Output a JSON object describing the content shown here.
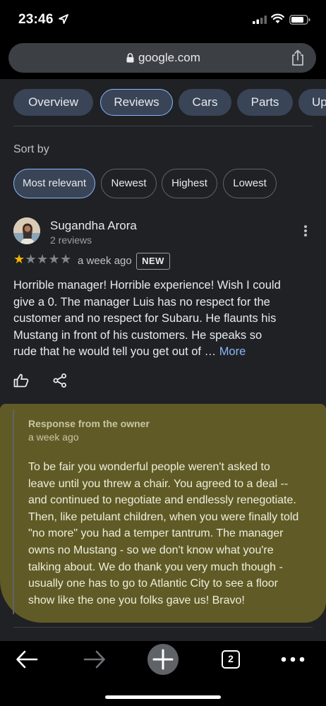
{
  "status_bar": {
    "time": "23:46",
    "icons": [
      "location-arrow-icon",
      "signal-icon",
      "wifi-icon",
      "battery-icon"
    ]
  },
  "browser": {
    "url": "google.com",
    "icons": [
      "lock-icon",
      "share-icon"
    ]
  },
  "tabs": [
    "Overview",
    "Reviews",
    "Cars",
    "Parts",
    "Up"
  ],
  "active_tab": "Reviews",
  "sort": {
    "label": "Sort by",
    "options": [
      "Most relevant",
      "Newest",
      "Highest",
      "Lowest"
    ],
    "selected": "Most relevant"
  },
  "review": {
    "author": "Sugandha Arora",
    "author_reviews": "2 reviews",
    "rating": 1,
    "max_rating": 5,
    "time": "a week ago",
    "badge": "NEW",
    "text_lines": [
      "Horrible manager! Horrible experience! Wish I could",
      "give a 0. The manager Luis has no respect for the",
      "customer and no respect for Subaru. He flaunts his",
      "Mustang in front of his customers. He speaks so",
      "rude that he would tell you get out of … "
    ],
    "more_label": "More",
    "icons": [
      "thumbs-up-icon",
      "share-icon",
      "more-vert-icon"
    ]
  },
  "owner_response": {
    "title": "Response from the owner",
    "time": "a week ago",
    "text_lines": [
      "To be fair you wonderful people weren't asked to",
      "leave until you threw a chair. You agreed to a deal --",
      "and continued to negotiate and endlessly renegotiate.",
      "Then, like petulant children, when you were finally told",
      "\"no more\" you had a temper tantrum. The manager",
      "owns no Mustang - so we don't know what you're",
      "talking about. We do thank you very much though -",
      "usually one has to go to Atlantic City to see a floor",
      "show like the one you folks gave us! Bravo!"
    ]
  },
  "toolbar": {
    "tab_count": "2",
    "icons": [
      "back-arrow-icon",
      "forward-arrow-icon",
      "plus-icon",
      "tabs-icon",
      "more-horiz-icon"
    ]
  },
  "colors": {
    "background": "#202124",
    "chip_active": "#394457",
    "accent_blue": "#8ab4f8",
    "star_filled": "#f6b400",
    "star_empty": "#80868b",
    "highlight": "#968c28"
  }
}
